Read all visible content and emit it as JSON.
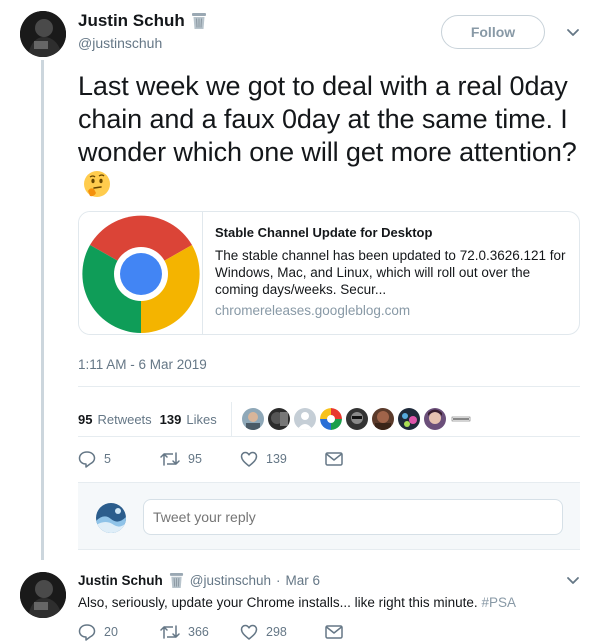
{
  "tweet": {
    "author": {
      "display_name": "Justin Schuh",
      "handle": "@justinschuh",
      "badge_icon": "wastebasket-icon"
    },
    "follow_label": "Follow",
    "text": "Last week we got to deal with a real 0day chain and a faux 0day at the same time. I wonder which one will get more attention?",
    "emoji": "thinking-face",
    "card": {
      "title": "Stable Channel Update for Desktop",
      "description": "The stable channel has been updated to 72.0.3626.121 for Windows, Mac, and Linux,   which will roll out over the coming days/weeks. Secur...",
      "domain": "chromereleases.googleblog.com",
      "image": "chrome-logo"
    },
    "timestamp": "1:11 AM - 6 Mar 2019",
    "stats": {
      "retweets_count": "95",
      "retweets_label": "Retweets",
      "likes_count": "139",
      "likes_label": "Likes",
      "liker_count": 10
    },
    "actions": {
      "replies": "5",
      "retweets": "95",
      "likes": "139"
    }
  },
  "reply_box": {
    "placeholder": "Tweet your reply"
  },
  "reply_tweet": {
    "display_name": "Justin Schuh",
    "handle": "@justinschuh",
    "separator": "·",
    "date": "Mar 6",
    "text": "Also, seriously, update your Chrome installs... like right this minute.",
    "hashtag": "#PSA",
    "actions": {
      "replies": "20",
      "retweets": "366",
      "likes": "298"
    }
  },
  "colors": {
    "secondary_text": "#657786",
    "border": "#e6ecf0",
    "link_muted": "#8899a6"
  }
}
